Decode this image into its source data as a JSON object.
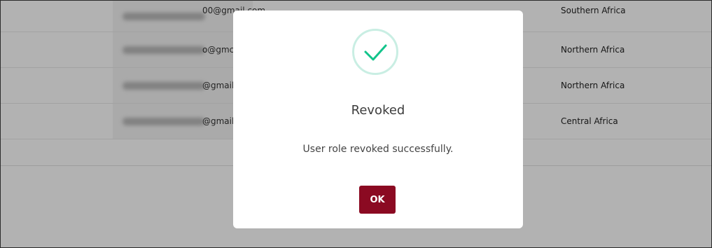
{
  "table": {
    "rows": [
      {
        "email_suffix": "00@gmail.com",
        "region": "Southern Africa"
      },
      {
        "email_suffix": "o@gmc",
        "region": "Northern Africa"
      },
      {
        "email_suffix": "@gmail.",
        "region": "Northern Africa"
      },
      {
        "email_suffix": "@gmail.c",
        "region": "Central Africa"
      }
    ]
  },
  "modal": {
    "icon": "checkmark-icon",
    "title": "Revoked",
    "message": "User role revoked successfully.",
    "ok_label": "OK",
    "colors": {
      "accent": "#12c48b",
      "ring": "#c9eee3",
      "button": "#8b0a22"
    }
  }
}
